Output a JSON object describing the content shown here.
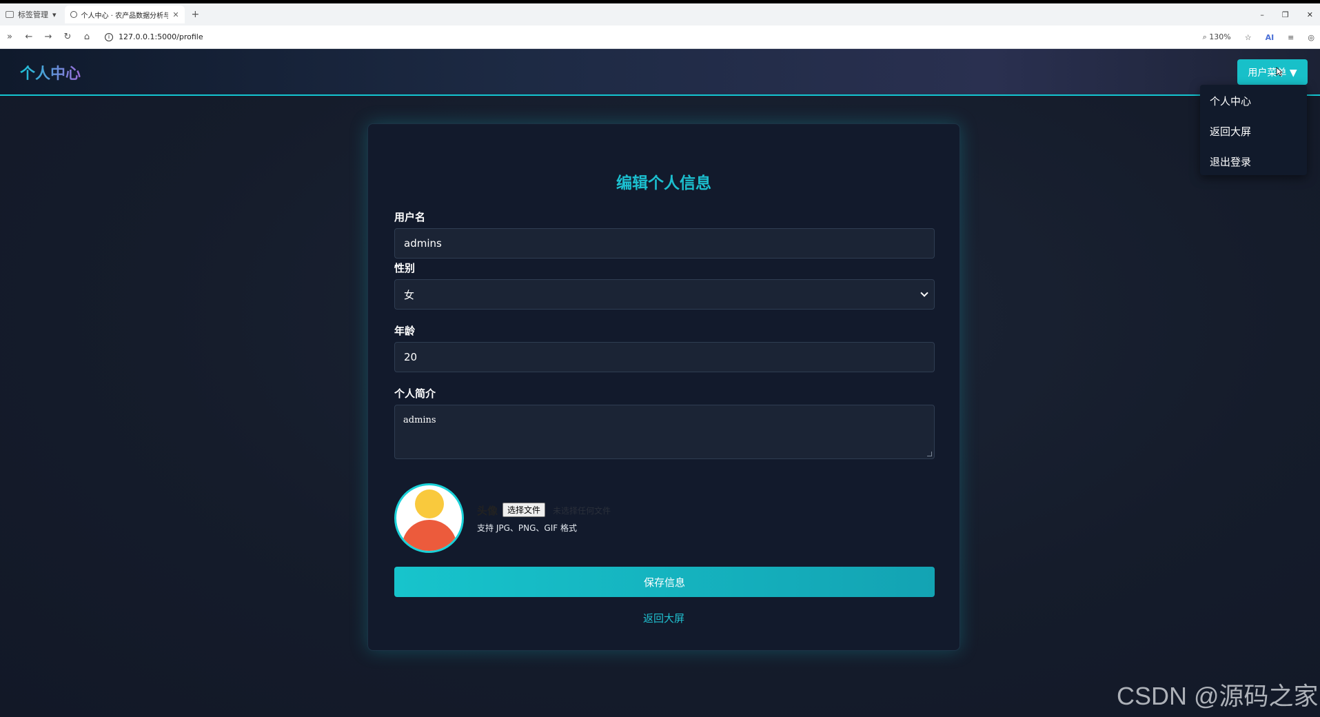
{
  "browser": {
    "tab_group_label": "标签管理",
    "tab_title": "个人中心 · 农产品数据分析与可",
    "tab_close": "✕",
    "new_tab": "+",
    "url": "127.0.0.1:5000/profile",
    "zoom": "130%",
    "ai_label": "AI"
  },
  "navbar": {
    "brand": "个人中心",
    "menu_button": "用户菜单 ▼",
    "dropdown": [
      "个人中心",
      "返回大屏",
      "退出登录"
    ]
  },
  "form": {
    "title": "编辑个人信息",
    "username_label": "用户名",
    "username_value": "admins",
    "gender_label": "性别",
    "gender_value": "女",
    "age_label": "年龄",
    "age_value": "20",
    "bio_label": "个人简介",
    "bio_value": "admins",
    "avatar_label": "头像",
    "file_button": "选择文件",
    "file_status": "未选择任何文件",
    "file_hint": "支持 JPG、PNG、GIF 格式",
    "save_button": "保存信息",
    "back_link": "返回大屏"
  },
  "watermark": "CSDN @源码之家",
  "colors": {
    "accent": "#18c0c9",
    "card_bg": "#121a2c",
    "page_bg": "#141b2a",
    "avatar_head": "#f9c93d",
    "avatar_body": "#ec5b3c"
  }
}
